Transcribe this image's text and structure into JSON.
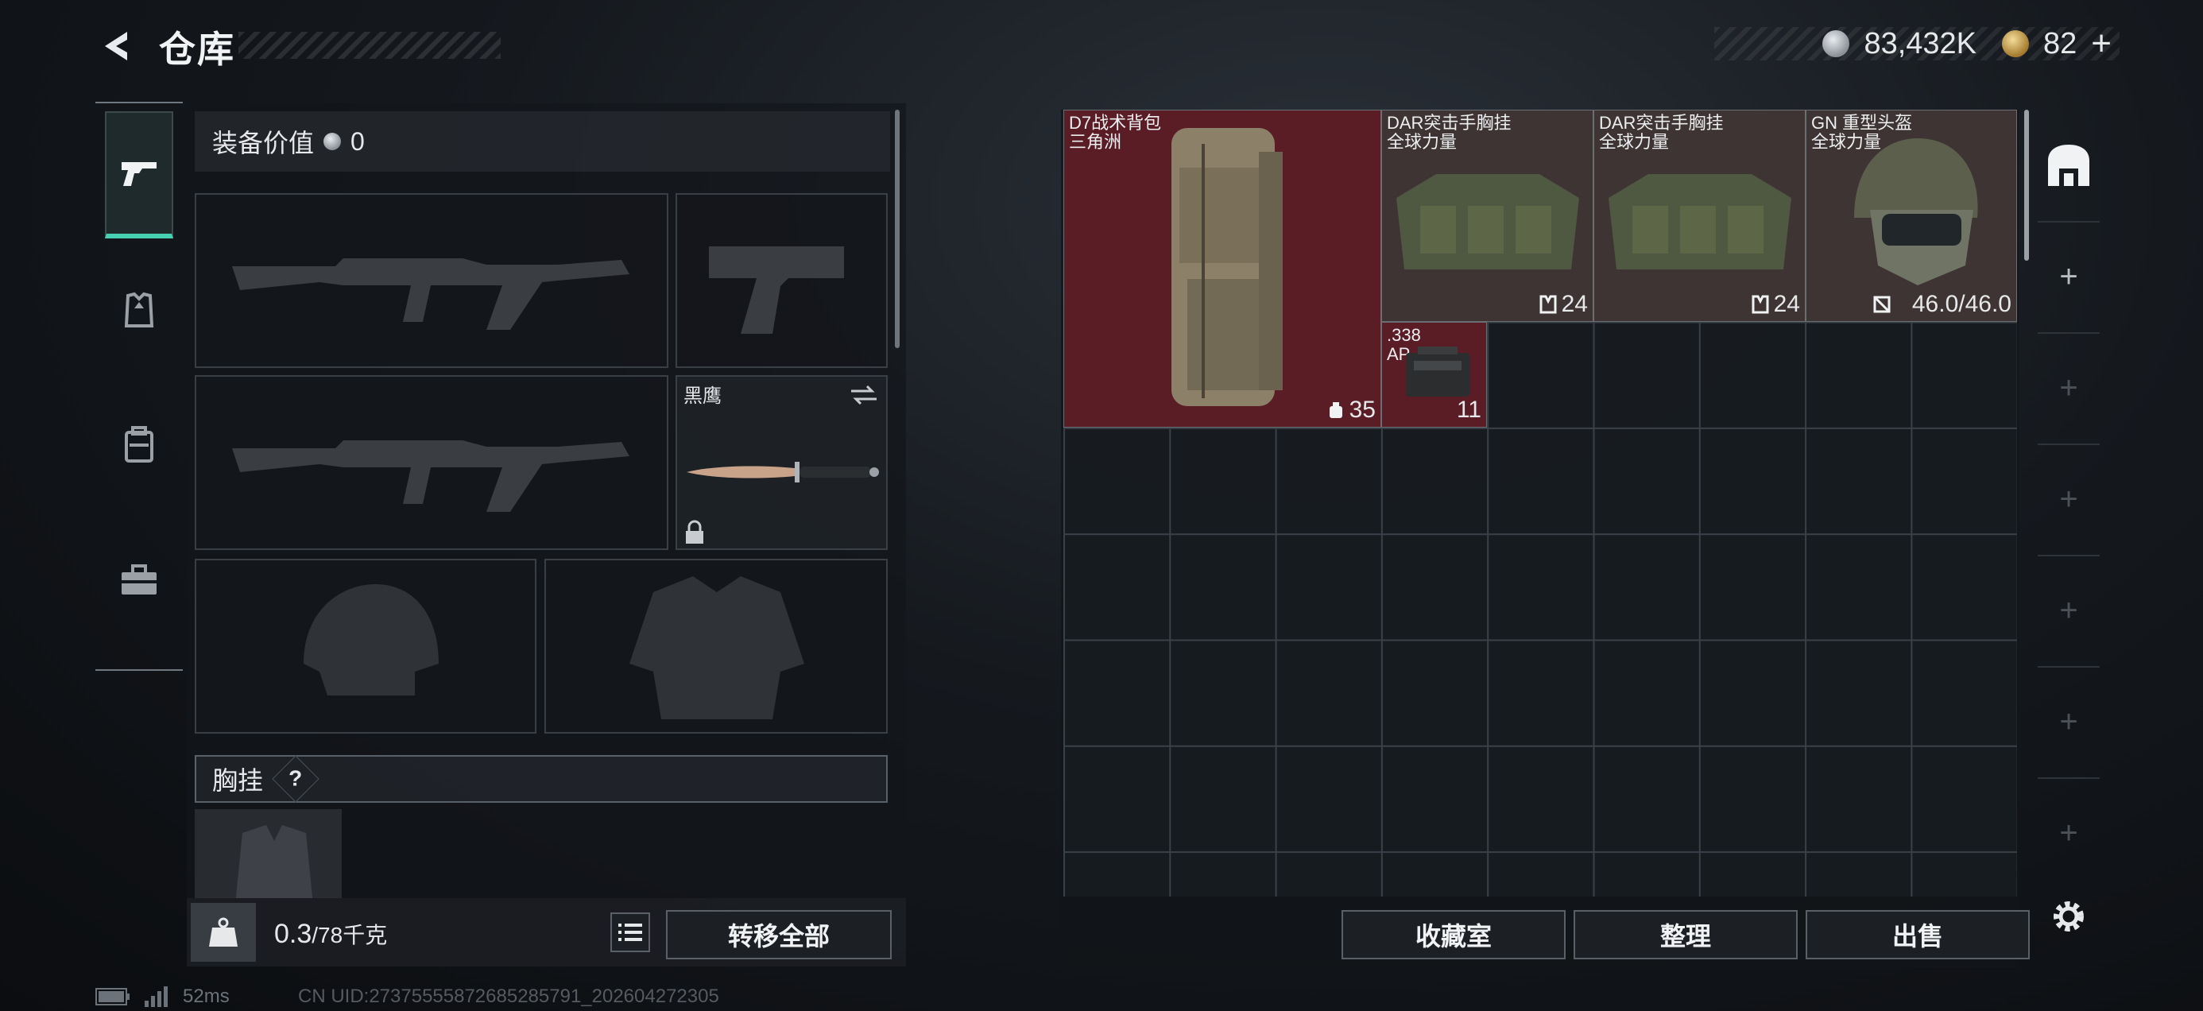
{
  "header": {
    "title": "仓库"
  },
  "currency": {
    "silver": "83,432K",
    "gold": "82",
    "gold_plus": "+"
  },
  "loadout": {
    "value_label": "装备价值",
    "value": "0",
    "melee_slot": {
      "name": "黑鹰"
    },
    "chest_rig_label": "胸挂",
    "chest_rig_help": "?"
  },
  "weight": {
    "current": "0.3",
    "max": "/78",
    "unit": "千克"
  },
  "buttons": {
    "transfer_all": "转移全部",
    "collection": "收藏室",
    "organize": "整理",
    "sell": "出售"
  },
  "stash_items": [
    {
      "name_line1": "D7战术背包",
      "name_line2": "三角洲",
      "count": "35",
      "count_icon": "capacity-icon"
    },
    {
      "name_line1": "DAR突击手胸挂",
      "name_line2": "全球力量",
      "count": "24",
      "count_icon": "rig-capacity-icon"
    },
    {
      "name_line1": "DAR突击手胸挂",
      "name_line2": "全球力量",
      "count": "24",
      "count_icon": "rig-capacity-icon"
    },
    {
      "name_line1": "GN 重型头盔",
      "name_line2": "全球力量",
      "count": "46.0/46.0",
      "count_icon": "durability-icon"
    },
    {
      "name_line1": ".338",
      "name_line2": "AP",
      "count": "11",
      "count_icon": ""
    }
  ],
  "right_column": {
    "add": "+"
  },
  "status": {
    "ping": "52ms",
    "uid": "CN UID:27375555872685285791_202604272305"
  },
  "colors": {
    "accent": "#46d1b2",
    "backpack_bg": "#5a1d26",
    "gear_bg": "#3d3433"
  }
}
